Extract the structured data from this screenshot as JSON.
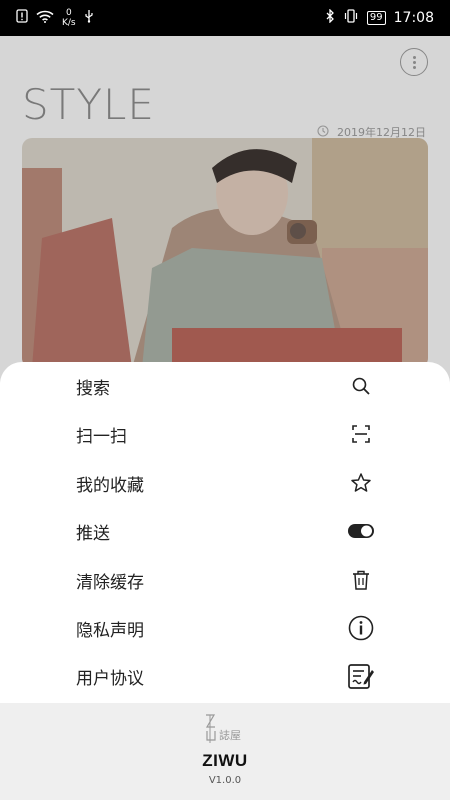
{
  "status_bar": {
    "net_speed_value": "0",
    "net_speed_unit": "K/s",
    "battery": "99",
    "time": "17:08"
  },
  "background": {
    "title": "STYLE",
    "date": "2019年12月12日"
  },
  "menu": {
    "items": [
      {
        "label": "搜索",
        "icon": "search-icon"
      },
      {
        "label": "扫一扫",
        "icon": "scan-icon"
      },
      {
        "label": "我的收藏",
        "icon": "star-icon"
      },
      {
        "label": "推送",
        "icon": "toggle-icon"
      },
      {
        "label": "清除缓存",
        "icon": "trash-icon"
      },
      {
        "label": "隐私声明",
        "icon": "info-icon"
      },
      {
        "label": "用户协议",
        "icon": "agreement-icon"
      }
    ]
  },
  "footer": {
    "logo_text": "ZI 誌屋",
    "app_name": "ZIWU",
    "version": "V1.0.0"
  },
  "colors": {
    "accent": "#222222",
    "footer_bg": "#efefef",
    "sheet_bg": "#ffffff"
  }
}
